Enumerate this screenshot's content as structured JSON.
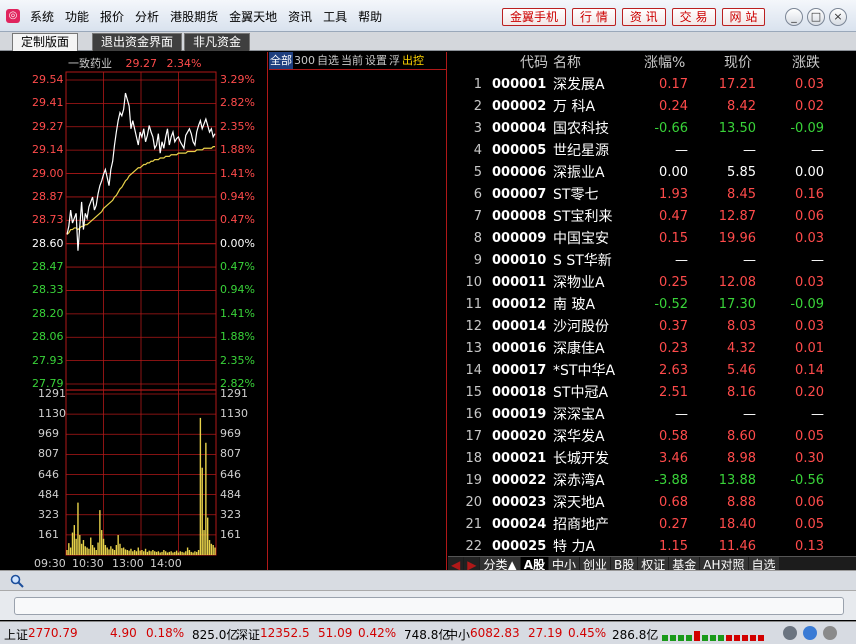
{
  "menu": {
    "items": [
      "系统",
      "功能",
      "报价",
      "分析",
      "港股期货",
      "金翼天地",
      "资讯",
      "工具",
      "帮助"
    ],
    "buttons": [
      "金翼手机",
      "行 情",
      "资 讯",
      "交 易",
      "网 站"
    ],
    "window_controls": [
      "_",
      "□",
      "×"
    ]
  },
  "tabs": [
    "定制版面",
    "退出资金界面",
    "非凡资金"
  ],
  "chart": {
    "stock_name": "一致药业",
    "price": "29.27",
    "pct": "2.34%",
    "price_labels": [
      "29.54",
      "29.41",
      "29.27",
      "29.14",
      "29.00",
      "28.87",
      "28.73",
      "28.60",
      "28.47",
      "28.33",
      "28.20",
      "28.06",
      "27.93",
      "27.79"
    ],
    "pct_labels": [
      "3.29%",
      "2.82%",
      "2.35%",
      "1.88%",
      "1.41%",
      "0.94%",
      "0.47%",
      "0.00%",
      "0.47%",
      "0.94%",
      "1.41%",
      "1.88%",
      "2.35%",
      "2.82%"
    ],
    "volume_labels": [
      "1291",
      "1130",
      "969",
      "807",
      "646",
      "484",
      "323",
      "161"
    ],
    "time_labels": [
      "09:30",
      "10:30",
      "13:00",
      "14:00"
    ],
    "prev_close": 28.6,
    "y_range": [
      27.73,
      29.6
    ],
    "price_series": [
      28.65,
      28.7,
      28.8,
      28.72,
      28.75,
      28.78,
      28.55,
      28.7,
      28.85,
      28.68,
      28.78,
      28.75,
      28.82,
      28.85,
      28.88,
      28.8,
      28.83,
      28.9,
      28.95,
      28.98,
      29.02,
      29.05,
      29.0,
      28.95,
      29.05,
      29.1,
      29.2,
      29.28,
      29.35,
      29.4,
      29.38,
      29.42,
      29.52,
      29.48,
      29.44,
      29.3,
      29.35,
      29.3,
      29.25,
      29.2,
      29.28,
      29.25,
      29.3,
      29.22,
      29.26,
      29.32,
      29.28,
      29.25,
      29.18,
      29.2,
      29.27,
      29.15,
      29.22,
      29.18,
      29.25,
      29.3,
      29.2,
      29.25,
      29.28,
      29.22,
      29.24,
      29.25,
      29.22,
      29.2,
      29.18,
      29.26,
      29.28,
      29.3,
      29.27,
      29.22,
      29.2,
      29.28,
      29.32,
      29.35,
      29.3,
      29.33,
      29.36,
      29.32,
      29.28,
      29.3,
      29.25,
      29.27
    ],
    "avg_series": [
      28.65,
      28.66,
      28.68,
      28.68,
      28.69,
      28.69,
      28.68,
      28.69,
      28.7,
      28.7,
      28.71,
      28.71,
      28.72,
      28.73,
      28.74,
      28.75,
      28.76,
      28.77,
      28.78,
      28.79,
      28.81,
      28.82,
      28.83,
      28.84,
      28.85,
      28.86,
      28.88,
      28.89,
      28.91,
      28.93,
      28.94,
      28.96,
      28.98,
      28.99,
      29.01,
      29.02,
      29.03,
      29.04,
      29.05,
      29.06,
      29.06,
      29.07,
      29.08,
      29.08,
      29.09,
      29.09,
      29.1,
      29.1,
      29.11,
      29.11,
      29.11,
      29.12,
      29.12,
      29.12,
      29.13,
      29.13,
      29.13,
      29.14,
      29.14,
      29.14,
      29.14,
      29.15,
      29.15,
      29.15,
      29.15,
      29.15,
      29.16,
      29.16,
      29.16,
      29.16,
      29.16,
      29.17,
      29.17,
      29.17,
      29.17,
      29.18,
      29.18,
      29.18,
      29.18,
      29.18,
      29.19,
      29.19
    ],
    "volume_max": 1291,
    "volume_series": [
      40,
      95,
      60,
      180,
      240,
      130,
      420,
      160,
      90,
      120,
      70,
      60,
      50,
      140,
      80,
      60,
      40,
      100,
      360,
      200,
      130,
      80,
      60,
      45,
      70,
      50,
      40,
      80,
      160,
      90,
      55,
      60,
      45,
      40,
      35,
      50,
      30,
      40,
      30,
      60,
      35,
      40,
      30,
      50,
      25,
      35,
      30,
      40,
      30,
      25,
      30,
      20,
      25,
      40,
      30,
      20,
      25,
      30,
      20,
      25,
      35,
      20,
      30,
      25,
      20,
      30,
      60,
      40,
      25,
      20,
      30,
      25,
      40,
      1100,
      700,
      200,
      900,
      300,
      120,
      90,
      80,
      60
    ]
  },
  "mid_tabs": [
    "全部",
    "300",
    "自选",
    "当前",
    "设置",
    "浮",
    "出控"
  ],
  "quote_headers": [
    "代码",
    "名称",
    "涨幅%",
    "现价",
    "涨跌"
  ],
  "quotes": [
    {
      "idx": "1",
      "code": "000001",
      "name": "深发展A",
      "chg": "0.17",
      "price": "17.21",
      "diff": "0.03",
      "dir": "up"
    },
    {
      "idx": "2",
      "code": "000002",
      "name": "万 科A",
      "chg": "0.24",
      "price": "8.42",
      "diff": "0.02",
      "dir": "up"
    },
    {
      "idx": "3",
      "code": "000004",
      "name": "国农科技",
      "chg": "-0.66",
      "price": "13.50",
      "diff": "-0.09",
      "dir": "down"
    },
    {
      "idx": "4",
      "code": "000005",
      "name": "世纪星源",
      "chg": "—",
      "price": "—",
      "diff": "—",
      "dir": "flat"
    },
    {
      "idx": "5",
      "code": "000006",
      "name": "深振业A",
      "chg": "0.00",
      "price": "5.85",
      "diff": "0.00",
      "dir": "flat"
    },
    {
      "idx": "6",
      "code": "000007",
      "name": "ST零七",
      "chg": "1.93",
      "price": "8.45",
      "diff": "0.16",
      "dir": "up"
    },
    {
      "idx": "7",
      "code": "000008",
      "name": "ST宝利来",
      "chg": "0.47",
      "price": "12.87",
      "diff": "0.06",
      "dir": "up"
    },
    {
      "idx": "8",
      "code": "000009",
      "name": "中国宝安",
      "chg": "0.15",
      "price": "19.96",
      "diff": "0.03",
      "dir": "up"
    },
    {
      "idx": "9",
      "code": "000010",
      "name": "S ST华新",
      "chg": "—",
      "price": "—",
      "diff": "—",
      "dir": "flat"
    },
    {
      "idx": "10",
      "code": "000011",
      "name": "深物业A",
      "chg": "0.25",
      "price": "12.08",
      "diff": "0.03",
      "dir": "up"
    },
    {
      "idx": "11",
      "code": "000012",
      "name": "南 玻A",
      "chg": "-0.52",
      "price": "17.30",
      "diff": "-0.09",
      "dir": "down"
    },
    {
      "idx": "12",
      "code": "000014",
      "name": "沙河股份",
      "chg": "0.37",
      "price": "8.03",
      "diff": "0.03",
      "dir": "up"
    },
    {
      "idx": "13",
      "code": "000016",
      "name": "深康佳A",
      "chg": "0.23",
      "price": "4.32",
      "diff": "0.01",
      "dir": "up"
    },
    {
      "idx": "14",
      "code": "000017",
      "name": "*ST中华A",
      "chg": "2.63",
      "price": "5.46",
      "diff": "0.14",
      "dir": "up"
    },
    {
      "idx": "15",
      "code": "000018",
      "name": "ST中冠A",
      "chg": "2.51",
      "price": "8.16",
      "diff": "0.20",
      "dir": "up"
    },
    {
      "idx": "16",
      "code": "000019",
      "name": "深深宝A",
      "chg": "—",
      "price": "—",
      "diff": "—",
      "dir": "flat"
    },
    {
      "idx": "17",
      "code": "000020",
      "name": "深华发A",
      "chg": "0.58",
      "price": "8.60",
      "diff": "0.05",
      "dir": "up"
    },
    {
      "idx": "18",
      "code": "000021",
      "name": "长城开发",
      "chg": "3.46",
      "price": "8.98",
      "diff": "0.30",
      "dir": "up"
    },
    {
      "idx": "19",
      "code": "000022",
      "name": "深赤湾A",
      "chg": "-3.88",
      "price": "13.88",
      "diff": "-0.56",
      "dir": "down"
    },
    {
      "idx": "20",
      "code": "000023",
      "name": "深天地A",
      "chg": "0.68",
      "price": "8.88",
      "diff": "0.06",
      "dir": "up"
    },
    {
      "idx": "21",
      "code": "000024",
      "name": "招商地产",
      "chg": "0.27",
      "price": "18.40",
      "diff": "0.05",
      "dir": "up"
    },
    {
      "idx": "22",
      "code": "000025",
      "name": "特 力A",
      "chg": "1.15",
      "price": "11.46",
      "diff": "0.13",
      "dir": "up"
    }
  ],
  "bottom_tabs": [
    "分类▲",
    "A股",
    "中小",
    "创业",
    "B股",
    "权证",
    "基金",
    "AH对照",
    "自选"
  ],
  "status": {
    "sh_label": "上证",
    "sh_value": "2770.79",
    "sh_change": "4.90",
    "sh_pct": "0.18%",
    "sh_amount": "825.0亿",
    "sz_label": "深证",
    "sz_value": "12352.5",
    "sz_change": "51.09",
    "sz_pct": "0.42%",
    "sz_amount": "748.8亿",
    "zx_label": "中小",
    "zx_value": "6082.83",
    "zx_change": "27.19",
    "zx_pct": "0.45%",
    "zx_amount": "286.8亿"
  },
  "colors": {
    "up": "#ff4b4b",
    "down": "#39d339",
    "grid": "#b01818",
    "price_line": "#ffffff",
    "avg_line": "#e8d24a",
    "volume": "#e8d24a"
  }
}
